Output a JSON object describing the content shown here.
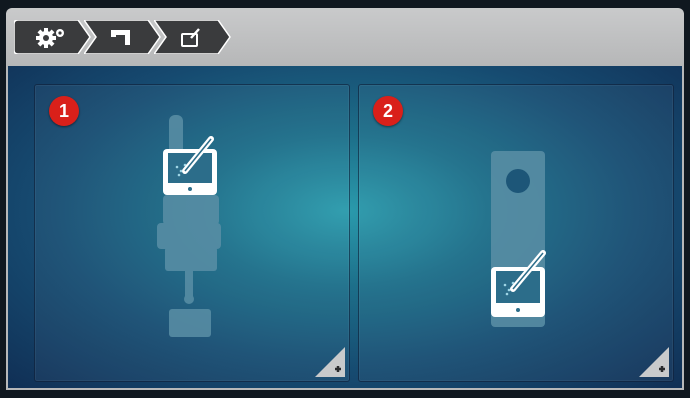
{
  "breadcrumbs": [
    {
      "icon": "settings-icon"
    },
    {
      "icon": "sewing-machine-icon"
    },
    {
      "icon": "tablet-edit-icon"
    }
  ],
  "cards": [
    {
      "number": "1",
      "illustration": "machine-with-tablet",
      "action": "plus-icon"
    },
    {
      "number": "2",
      "illustration": "stick-with-tablet",
      "action": "plus-icon"
    }
  ],
  "colors": {
    "badge": "#d9201a",
    "panel_center": "#2a9aac",
    "panel_edge": "#102f55",
    "topbar": "#c0c1c2"
  }
}
